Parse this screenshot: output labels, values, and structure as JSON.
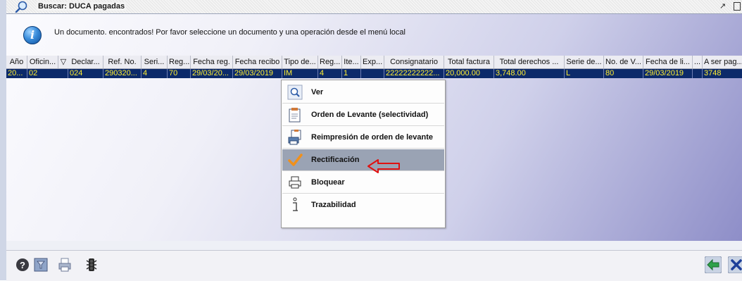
{
  "window": {
    "title": "Buscar: DUCA pagadas",
    "controls": [
      "restore-icon",
      "close-icon"
    ]
  },
  "message": {
    "icon": "info-icon",
    "text": "Un documento. encontrados! Por favor seleccione un documento y una operación desde el menú local"
  },
  "table": {
    "headers": [
      "Año",
      "Oficin...",
      "▽",
      "Declar...",
      "Ref. No.",
      "Seri...",
      "Reg...",
      "Fecha reg.",
      "Fecha recibo",
      "Tipo de...",
      "Reg...",
      "Ite...",
      "Exp...",
      "Consignatario",
      "Total factura",
      "Total derechos ...",
      "Serie de...",
      "No. de V...",
      "Fecha de li...",
      "...",
      "A ser pag..."
    ],
    "row": [
      "20...",
      "02",
      "",
      "024",
      "290320...",
      "4",
      "70",
      "29/03/20...",
      "29/03/2019",
      "IM",
      "4",
      "1",
      "",
      "22222222222...",
      "20,000.00",
      "3,748.00",
      "L",
      "80",
      "29/03/2019",
      "",
      "3748"
    ]
  },
  "context_menu": {
    "items": [
      {
        "label": "Ver",
        "icon": "magnifier-icon"
      },
      {
        "label": "Orden de Levante (selectividad)",
        "icon": "document-icon"
      },
      {
        "label": "Reimpresión de orden de levante",
        "icon": "print-document-icon"
      },
      {
        "label": "Rectificación",
        "icon": "checkmark-icon",
        "selected": true
      },
      {
        "label": "Bloquear",
        "icon": "printer-icon"
      },
      {
        "label": "Trazabilidad",
        "icon": "trace-icon"
      }
    ]
  },
  "toolbar": {
    "icons": [
      "help-icon",
      "filter-icon",
      "printer-icon",
      "traffic-light-icon"
    ],
    "right_icons": [
      "back-arrow-icon",
      "close-icon"
    ]
  },
  "colors": {
    "selected_row_bg": "#0c2a6a",
    "selected_row_text": "#ffef32",
    "menu_selected_bg": "#9aa3b4",
    "annotation_arrow": "#e01010"
  }
}
